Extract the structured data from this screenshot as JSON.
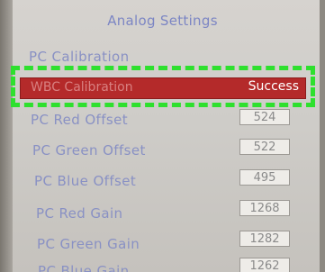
{
  "title": "Analog Settings",
  "items": [
    {
      "label": "PC Calibration"
    },
    {
      "label": "WBC Calibration",
      "value": "Success"
    },
    {
      "label": "PC Red Offset",
      "value": "524"
    },
    {
      "label": "PC Green Offset",
      "value": "522"
    },
    {
      "label": "PC Blue Offset",
      "value": "495"
    },
    {
      "label": "PC Red Gain",
      "value": "1268"
    },
    {
      "label": "PC Green Gain",
      "value": "1282"
    },
    {
      "label": "PC Blue Gain",
      "value": "1262"
    }
  ],
  "colors": {
    "label_text": "#8991c4",
    "selected_bg": "#b42a2a",
    "highlight_outline": "#2ee02e"
  }
}
